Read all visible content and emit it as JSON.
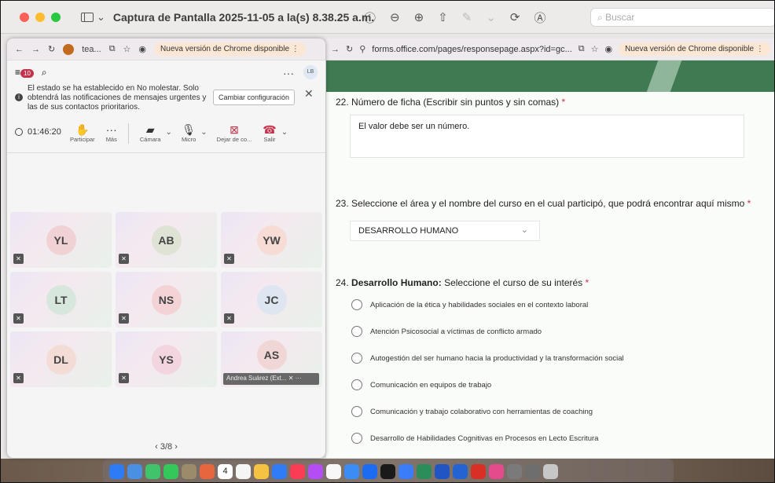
{
  "preview": {
    "title": "Captura de Pantalla 2025-11-05 a la(s) 8.38.25 a.m.",
    "search_placeholder": "Buscar"
  },
  "teams_browser": {
    "tab_label": "tea...",
    "update_label": "Nueva versión de Chrome disponible"
  },
  "teams": {
    "activity_count": "10",
    "user_initials": "LB",
    "notice": {
      "message": "El estado se ha establecido en No molestar. Solo obtendrá las notificaciones de mensajes urgentes y las de sus contactos prioritarios.",
      "button": "Cambiar configuración"
    },
    "meeting": {
      "timer": "01:46:20",
      "controls": [
        "Participar",
        "Más",
        "Cámara",
        "Micro",
        "Dejar de co...",
        "Salir"
      ]
    },
    "participants": [
      {
        "initials": "YL",
        "color": "#f1d2d4"
      },
      {
        "initials": "AB",
        "color": "#dfe3d5"
      },
      {
        "initials": "YW",
        "color": "#f6dcd5"
      },
      {
        "initials": "LT",
        "color": "#d8e7de"
      },
      {
        "initials": "NS",
        "color": "#f3d3d6"
      },
      {
        "initials": "JC",
        "color": "#dde6f1"
      },
      {
        "initials": "DL",
        "color": "#f4dcd6"
      },
      {
        "initials": "YS",
        "color": "#f2d5de"
      },
      {
        "initials": "AS",
        "color": "#f1d6d6",
        "name": "Andrea Suárez (Ext..."
      }
    ],
    "pager": "3/8"
  },
  "form_browser": {
    "url": "forms.office.com/pages/responsepage.aspx?id=gc...",
    "update_label": "Nueva versión de Chrome disponible"
  },
  "form": {
    "q22": {
      "number": "22.",
      "text": "Número de ficha (Escribir sin puntos y sin comas)",
      "required": "*",
      "answer": "El valor debe ser un número."
    },
    "q23": {
      "number": "23.",
      "text": "Seleccione el área y el nombre del curso en el cual participó, que podrá encontrar aquí mismo",
      "required": "*",
      "selected": "DESARROLLO HUMANO"
    },
    "q24": {
      "number": "24.",
      "bold": "Desarrollo Humano:",
      "text": "Seleccione el curso de su interés",
      "required": "*",
      "options": [
        "Aplicación de la ética y habilidades sociales en el contexto laboral",
        "Atención Psicosocial a víctimas de conflicto armado",
        "Autogestión del ser humano hacia la productividad y la transformación social",
        "Comunicación en equipos de trabajo",
        "Comunicación y trabajo colaborativo con herramientas de coaching",
        "Desarrollo de Habilidades Cognitivas en Procesos en Lecto Escritura"
      ]
    }
  },
  "dock": {
    "calendar_day": "4",
    "apps": [
      "#2e7bf6",
      "#4a90e2",
      "#3fc46b",
      "#34c759",
      "#9b8b6a",
      "#e8663d",
      "#ffffff",
      "#f5f5f5",
      "#f5c242",
      "#2f7cf6",
      "#fb3c55",
      "#b54df5",
      "#f7f7f7",
      "#3a8df5",
      "#1c6cf2",
      "#1a1a1a",
      "#3b7df8",
      "#2a8d5a",
      "#2055c3",
      "#2364d2",
      "#d93025",
      "#e44b8c",
      "#7a7a7a",
      "#6e6e6e",
      "#c7c7c7"
    ]
  }
}
